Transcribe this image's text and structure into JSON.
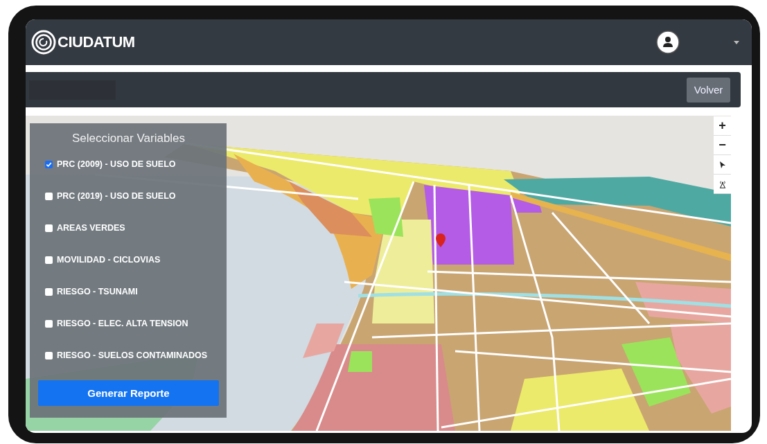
{
  "navbar": {
    "brand": "CIUDATUM"
  },
  "toolbar": {
    "back_button": "Volver"
  },
  "panel": {
    "title": "Seleccionar Variables",
    "variables": [
      {
        "label": "PRC (2009) - USO DE SUELO",
        "checked": true
      },
      {
        "label": "PRC (2019) - USO DE SUELO",
        "checked": false
      },
      {
        "label": "AREAS VERDES",
        "checked": false
      },
      {
        "label": "MOVILIDAD - CICLOVIAS",
        "checked": false
      },
      {
        "label": "RIESGO - TSUNAMI",
        "checked": false
      },
      {
        "label": "RIESGO - ELEC. ALTA TENSION",
        "checked": false
      },
      {
        "label": "RIESGO - SUELOS CONTAMINADOS",
        "checked": false
      }
    ],
    "button": "Generar Reporte"
  },
  "map_controls": [
    {
      "kind": "zoom-in",
      "symbol": "+"
    },
    {
      "kind": "zoom-out",
      "symbol": "−"
    },
    {
      "kind": "compass"
    },
    {
      "kind": "antenna"
    }
  ]
}
